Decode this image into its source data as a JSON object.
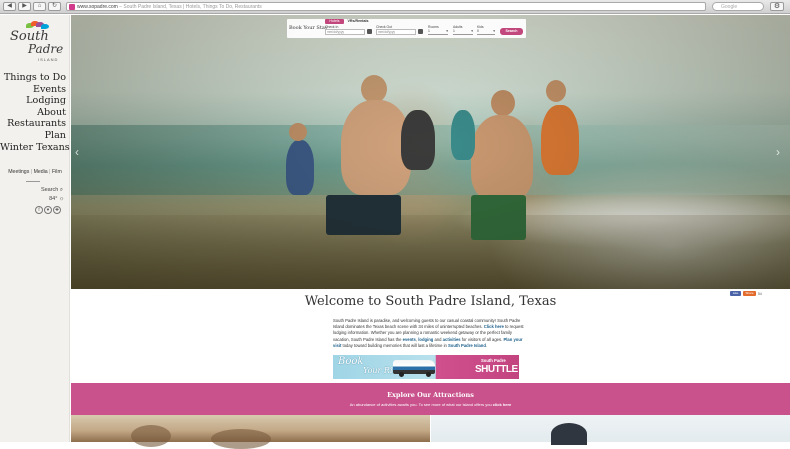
{
  "browser": {
    "nav_buttons": [
      "◀",
      "▶",
      "⌂",
      "↻",
      "+"
    ],
    "url_host": "www.sopadre.com",
    "url_title": " – South Padre Island, Texas | Hotels, Things To Do, Restaurants",
    "search_placeholder": "Google",
    "gear_icon": "gear-icon"
  },
  "logo": {
    "line1": "South",
    "line2": "Padre",
    "line3": "ISLAND",
    "leaf_colors": [
      "#7ac143",
      "#f15a29",
      "#9b4f96",
      "#00a3d9"
    ]
  },
  "sidebar": {
    "nav": [
      {
        "id": "things-to-do",
        "label": "Things to Do"
      },
      {
        "id": "events",
        "label": "Events"
      },
      {
        "id": "lodging",
        "label": "Lodging"
      },
      {
        "id": "about",
        "label": "About"
      },
      {
        "id": "restaurants",
        "label": "Restaurants"
      },
      {
        "id": "plan",
        "label": "Plan"
      },
      {
        "id": "winter-texans",
        "label": "Winter Texans"
      }
    ],
    "sub_links": [
      "Meetings",
      "Media",
      "Film"
    ],
    "search_label": "Search",
    "temperature": "84°",
    "social": [
      "f",
      "♥",
      "✚"
    ]
  },
  "booking": {
    "label": "Book Your Stay",
    "tabs": [
      "Hotels",
      "VRs/Rentals"
    ],
    "check_in_label": "Check In",
    "check_in_placeholder": "mm/dd/yyyy",
    "check_out_label": "Check Out",
    "check_out_placeholder": "mm/dd/yyyy",
    "rooms_label": "Rooms",
    "rooms_value": "1",
    "adults_label": "Adults",
    "adults_value": "1",
    "kids_label": "Kids",
    "kids_value": "0",
    "search_button": "Search"
  },
  "share": {
    "facebook": "Like",
    "save": "Share",
    "count": "54"
  },
  "welcome": {
    "title": "Welcome to South Padre Island, Texas",
    "p1": "South Padre Island is paradise, and welcoming guests to our casual coastal community! South Padre Island dominates the Texas beach scene with 34 miles of uninterrupted beaches. ",
    "l1": "Click here",
    "p2": " to request lodging information. Whether you are planning a romantic weekend getaway or the perfect family vacation, South Padre Island has the ",
    "l2": "events",
    "p3": ", ",
    "l3": "lodging",
    "p4": " and ",
    "l4": "activities",
    "p5": " for visitors of all ages. ",
    "l5": "Plan your visit",
    "p6": " today toward building memories that will last a lifetime in ",
    "l6": "South Padre Island",
    "p7": "."
  },
  "banner": {
    "book": "Book",
    "your_ride": "Your Ride",
    "south_padre": "South Padre",
    "shuttle": "SHUTTLE"
  },
  "attractions": {
    "heading": "Explore Our Attractions",
    "subtext": "An abundance of activities awaits you. To see more of what our island offers you ",
    "link": "click here"
  },
  "colors": {
    "brand_pink": "#c9528d",
    "link_blue": "#1b5e8a",
    "sidebar_bg": "#f2f1ed"
  }
}
